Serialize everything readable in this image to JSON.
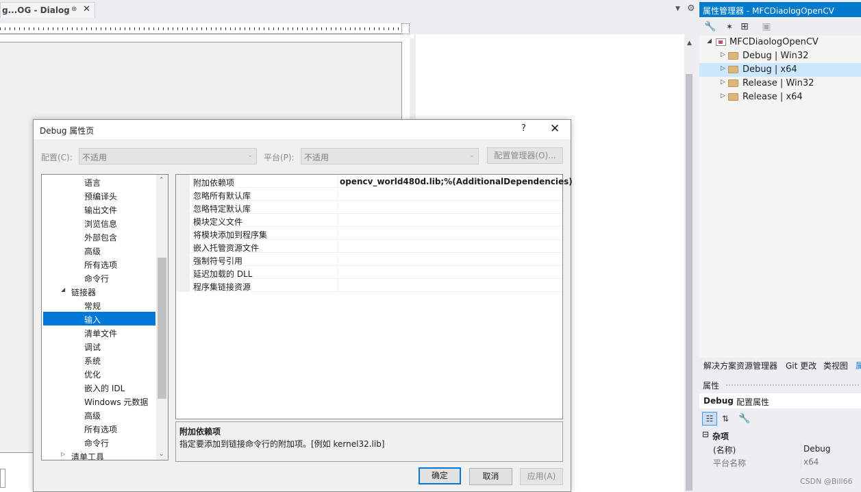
{
  "editor": {
    "doc_tab_title": "g...OG - Dialog",
    "pin_glyph": "⊕",
    "close_glyph": "✕"
  },
  "property_manager": {
    "title": "属性管理器 - MFCDiaologOpenCV",
    "toolbar_icons": [
      "wrench-icon",
      "magic-wand-icon",
      "add-existing-sheet-icon",
      "save-icon"
    ],
    "tree": {
      "project": "MFCDiaologOpenCV",
      "configs": [
        "Debug | Win32",
        "Debug | x64",
        "Release | Win32",
        "Release | x64"
      ],
      "selected": "Debug | x64"
    },
    "bottom_tabs": [
      "解决方案资源管理器",
      "Git 更改",
      "类视图",
      "属"
    ]
  },
  "properties_window": {
    "header": "属性",
    "object_name": "Debug",
    "object_type": "配置属性",
    "category": "杂项",
    "rows": [
      {
        "key": "(名称)",
        "value": "Debug"
      },
      {
        "key": "平台名称",
        "value": "x64"
      }
    ]
  },
  "watermark": "CSDN @Bill66",
  "dialog": {
    "title": "Debug 属性页",
    "help": "?",
    "close": "✕",
    "config_label": "配置(C):",
    "config_value": "不适用",
    "platform_label": "平台(P):",
    "platform_value": "不适用",
    "config_manager_button": "配置管理器(O)...",
    "nav_items": [
      {
        "label": "语言",
        "indent": 2
      },
      {
        "label": "预编译头",
        "indent": 2
      },
      {
        "label": "输出文件",
        "indent": 2
      },
      {
        "label": "浏览信息",
        "indent": 2
      },
      {
        "label": "外部包含",
        "indent": 2
      },
      {
        "label": "高级",
        "indent": 2
      },
      {
        "label": "所有选项",
        "indent": 2
      },
      {
        "label": "命令行",
        "indent": 2
      },
      {
        "label": "链接器",
        "indent": 1,
        "expanded": true
      },
      {
        "label": "常规",
        "indent": 2
      },
      {
        "label": "输入",
        "indent": 2,
        "selected": true
      },
      {
        "label": "清单文件",
        "indent": 2
      },
      {
        "label": "调试",
        "indent": 2
      },
      {
        "label": "系统",
        "indent": 2
      },
      {
        "label": "优化",
        "indent": 2
      },
      {
        "label": "嵌入的 IDL",
        "indent": 2
      },
      {
        "label": "Windows 元数据",
        "indent": 2
      },
      {
        "label": "高级",
        "indent": 2
      },
      {
        "label": "所有选项",
        "indent": 2
      },
      {
        "label": "命令行",
        "indent": 2
      },
      {
        "label": "清单工具",
        "indent": 1,
        "expanded": false
      }
    ],
    "grid_rows": [
      {
        "key": "附加依赖项",
        "value": "opencv_world480d.lib;%(AdditionalDependencies)"
      },
      {
        "key": "忽略所有默认库",
        "value": ""
      },
      {
        "key": "忽略特定默认库",
        "value": ""
      },
      {
        "key": "模块定义文件",
        "value": ""
      },
      {
        "key": "将模块添加到程序集",
        "value": ""
      },
      {
        "key": "嵌入托管资源文件",
        "value": ""
      },
      {
        "key": "强制符号引用",
        "value": ""
      },
      {
        "key": "延迟加载的 DLL",
        "value": ""
      },
      {
        "key": "程序集链接资源",
        "value": ""
      }
    ],
    "description": {
      "title": "附加依赖项",
      "text": "指定要添加到链接命令行的附加项。[例如 kernel32.lib]"
    },
    "buttons": {
      "ok": "确定",
      "cancel": "取消",
      "apply": "应用(A)"
    }
  }
}
